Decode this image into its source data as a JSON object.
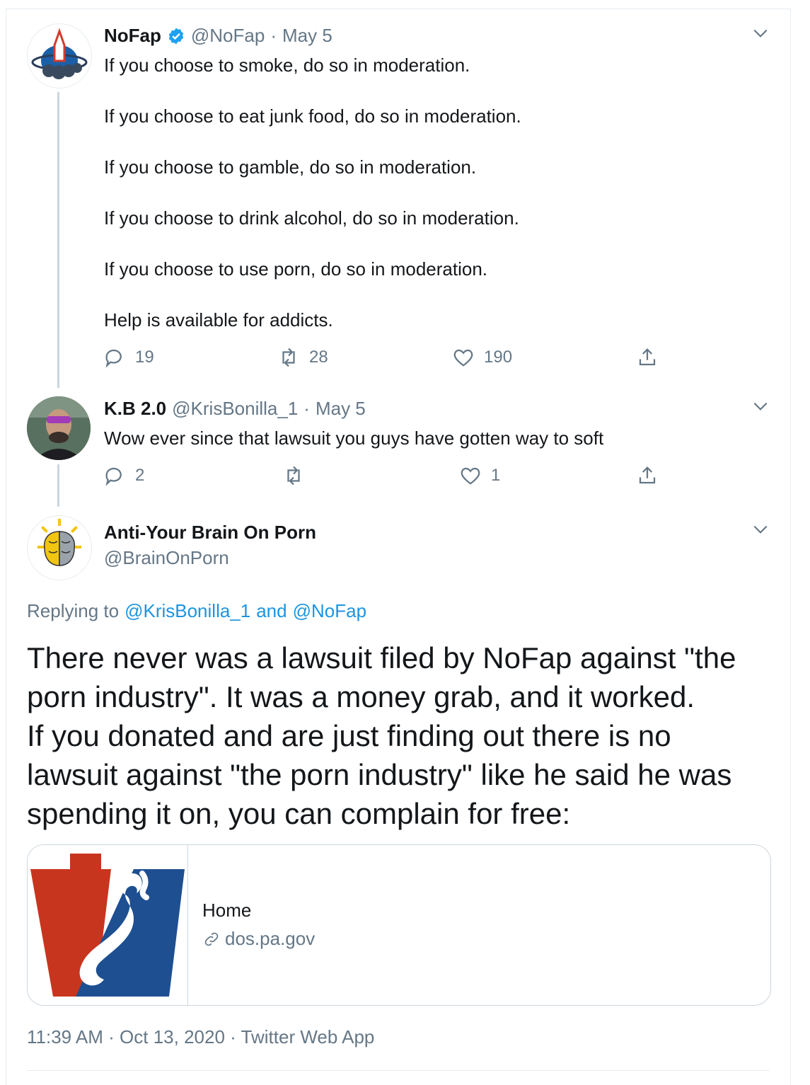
{
  "tweets": [
    {
      "name": "NoFap",
      "verified": true,
      "handle": "@NoFap",
      "sep": "·",
      "date": "May 5",
      "lines": [
        "If you choose to smoke, do so in moderation.",
        "If you choose to eat junk food, do so in moderation.",
        "If you choose to gamble, do so in moderation.",
        "If you choose to drink alcohol, do so in moderation.",
        "If you choose to use porn, do so in moderation.",
        "Help is available for addicts."
      ],
      "replies": "19",
      "retweets": "28",
      "likes": "190"
    },
    {
      "name": "K.B 2.0",
      "handle": "@KrisBonilla_1",
      "sep": "·",
      "date": "May 5",
      "text": "Wow ever since that lawsuit you guys have gotten way to soft",
      "replies": "2",
      "retweets": "",
      "likes": "1"
    }
  ],
  "main_tweet": {
    "name": "Anti-Your Brain On Porn",
    "handle": "@BrainOnPorn",
    "replying_prefix": "Replying to",
    "reply_user_1": "@KrisBonilla_1",
    "reply_and": "and",
    "reply_user_2": "@NoFap",
    "text_lines": [
      "There never was a lawsuit filed by NoFap against \"the",
      "porn industry\". It was a money grab, and it worked.",
      "If you donated and are just finding out there is no",
      "lawsuit against \"the porn industry\" like he said he was",
      "spending it on, you can complain for free:"
    ],
    "card": {
      "title": "Home",
      "domain": "dos.pa.gov",
      "link_icon": "link-icon"
    },
    "meta": "11:39 AM · Oct 13, 2020 · Twitter Web App"
  },
  "colors": {
    "accent": "#1b95e0",
    "secondary": "#657786",
    "verified": "#1da1f2",
    "border": "#ccd6dd"
  }
}
